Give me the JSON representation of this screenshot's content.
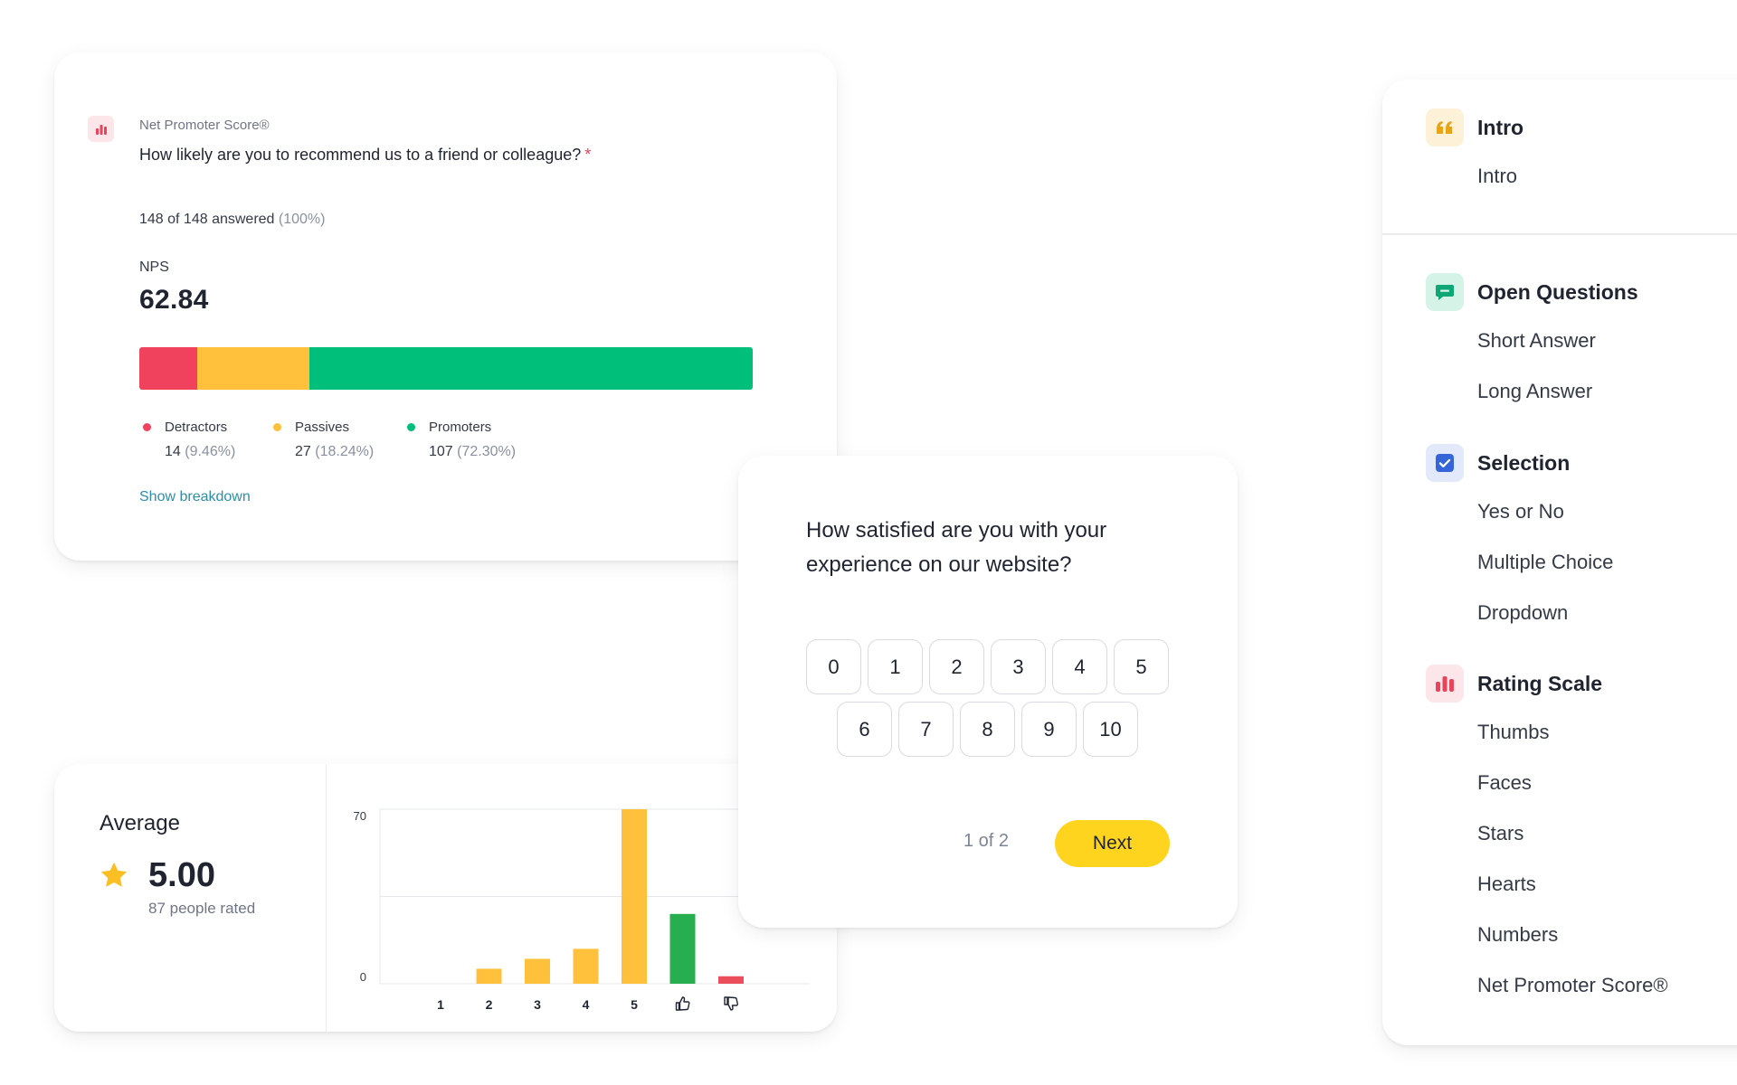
{
  "nps_card": {
    "type_label": "Net Promoter Score®",
    "question": "How likely are you to recommend us to a friend or colleague?",
    "required_mark": "*",
    "answered": "148 of 148 answered",
    "answered_pct": "(100%)",
    "nps_label": "NPS",
    "nps_value": "62.84",
    "legend": [
      {
        "name": "Detractors",
        "count": "14",
        "pct": "(9.46%)",
        "color": "#f0425c",
        "share": 9.46
      },
      {
        "name": "Passives",
        "count": "27",
        "pct": "(18.24%)",
        "color": "#ffc13b",
        "share": 18.24
      },
      {
        "name": "Promoters",
        "count": "107",
        "pct": "(72.30%)",
        "color": "#00bf7a",
        "share": 72.3
      }
    ],
    "show_breakdown": "Show breakdown",
    "icon": "bar-chart-icon"
  },
  "avg_card": {
    "title": "Average",
    "value": "5.00",
    "people": "87 people rated",
    "icon": "star-icon",
    "star_color": "#fbbf24"
  },
  "chart_data": {
    "type": "bar",
    "categories": [
      "1",
      "2",
      "3",
      "4",
      "5",
      "thumbs-up",
      "thumbs-down"
    ],
    "values": [
      0,
      6,
      10,
      14,
      70,
      28,
      3
    ],
    "colors": [
      "#ffc13b",
      "#ffc13b",
      "#ffc13b",
      "#ffc13b",
      "#ffc13b",
      "#27ae4f",
      "#eb4d5a"
    ],
    "ylim": [
      0,
      70
    ],
    "yticks": [
      "0",
      "70"
    ],
    "xlabel": "",
    "ylabel": "",
    "title": "",
    "grid": true
  },
  "rating_card": {
    "question": "How satisfied are you with your experience on our website?",
    "options_row1": [
      "0",
      "1",
      "2",
      "3",
      "4",
      "5"
    ],
    "options_row2": [
      "6",
      "7",
      "8",
      "9",
      "10"
    ],
    "pager": "1 of 2",
    "next_label": "Next",
    "next_color": "#ffd41f"
  },
  "question_types": {
    "groups": [
      {
        "title": "Intro",
        "icon": "quote-icon",
        "color": "#fdf1d8",
        "items": [
          "Intro"
        ]
      },
      {
        "title": "Open Questions",
        "icon": "chat-bubble-icon",
        "color": "#d6f3e8",
        "items": [
          "Short Answer",
          "Long Answer"
        ]
      },
      {
        "title": "Selection",
        "icon": "checkbox-icon",
        "color": "#e2e9fb",
        "items": [
          "Yes or No",
          "Multiple Choice",
          "Dropdown"
        ]
      },
      {
        "title": "Rating Scale",
        "icon": "bar-chart-icon",
        "color": "#fde6ea",
        "items": [
          "Thumbs",
          "Faces",
          "Stars",
          "Hearts",
          "Numbers",
          "Net Promoter Score®"
        ]
      }
    ]
  }
}
